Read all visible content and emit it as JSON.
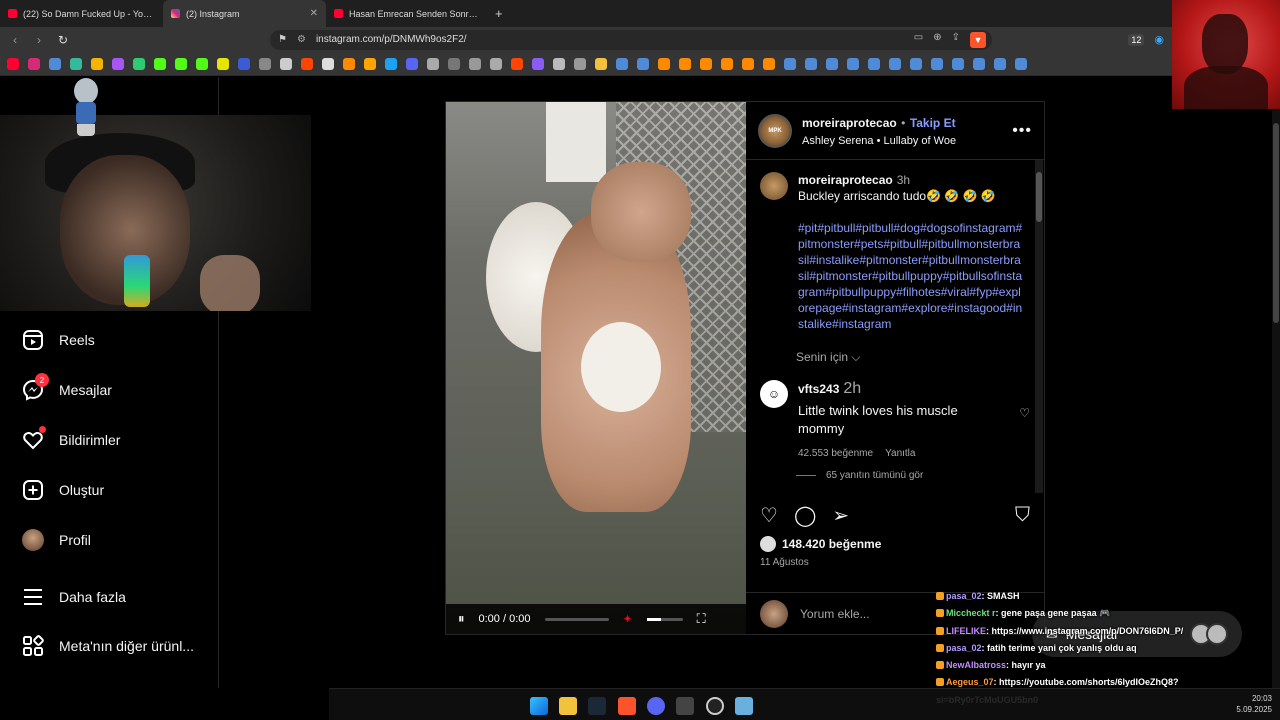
{
  "browser": {
    "tabs": [
      {
        "title": "(22) So Damn Fucked Up - YouTube",
        "color": "#ff0033",
        "active": false
      },
      {
        "title": "(2) Instagram",
        "color": "#d62976",
        "active": true
      },
      {
        "title": "Hasan Emrecan Senden Sonra - YouTube",
        "color": "#ff0033",
        "active": false
      }
    ],
    "url": "instagram.com/p/DNMWh9os2F2/",
    "extension_badge": "12"
  },
  "sidebar": {
    "items": [
      {
        "label": "Reels",
        "icon": "reels-icon"
      },
      {
        "label": "Mesajlar",
        "icon": "messenger-icon",
        "badge": "2"
      },
      {
        "label": "Bildirimler",
        "icon": "heart-icon"
      },
      {
        "label": "Oluştur",
        "icon": "plus-square-icon"
      },
      {
        "label": "Profil",
        "icon": "profile-avatar"
      },
      {
        "label": "Daha fazla",
        "icon": "hamburger-icon"
      },
      {
        "label": "Meta'nın diğer ürünl...",
        "icon": "grid-icon"
      }
    ]
  },
  "post": {
    "username": "moreiraprotecao",
    "separator": "•",
    "follow": "Takip Et",
    "audio": "Ashley Serena • Lullaby of Woe",
    "logo_text": "MPK",
    "video_time": "0:00 / 0:00",
    "caption": {
      "username": "moreiraprotecao",
      "time": "3h",
      "text": "Buckley arriscando tudo🤣 🤣 🤣 🤣",
      "hashtags": "#pit#pitbull#pitbull#dog#dogsofinstagram#pitmonster#pets#pitbull#pitbullmonsterbrasil#instalike#pitmonster#pitbullmonsterbrasil#pitmonster#pitbullpuppy#pitbullsofinstagram#pitbullpuppy#filhotes#viral#fyp#explorepage#instagram#explore#instagood#instalike#instagram"
    },
    "senin_icin": "Senin için ⌵",
    "comment": {
      "username": "vfts243",
      "time": "2h",
      "text": "Little twink loves his muscle mommy",
      "likes": "42.553 beğenme",
      "reply": "Yanıtla",
      "view_replies": "65 yanıtın tümünü gör"
    },
    "likes": "148.420 beğenme",
    "date": "11 Ağustos",
    "add_comment_placeholder": "Yorum ekle..."
  },
  "chat": [
    {
      "user": "pasa_02",
      "msg": ": SMASH",
      "cls": "n1"
    },
    {
      "user": "Miccheckt r",
      "msg": ": gene paşa gene paşaa 🎮",
      "cls": "n2"
    },
    {
      "user": "LIFELIKE",
      "msg": ": https://www.instagram.com/p/DON76I6DN_P/",
      "cls": "n3"
    },
    {
      "user": "pasa_02",
      "msg": ": fatih terime yani çok yanlış oldu aq",
      "cls": "n1"
    },
    {
      "user": "NewAlbatross",
      "msg": ": hayır ya",
      "cls": "n3"
    },
    {
      "user": "Aegeus_07",
      "msg": ": https://youtube.com/shorts/6lydIOeZhQ8?",
      "cls": "n4"
    },
    {
      "user": "",
      "msg": "si=bRy0rTcMuUGU5bn0",
      "cls": ""
    }
  ],
  "messages_pill": "Mesajlar",
  "clock": {
    "time": "20:03",
    "date": "5.09.2025"
  }
}
